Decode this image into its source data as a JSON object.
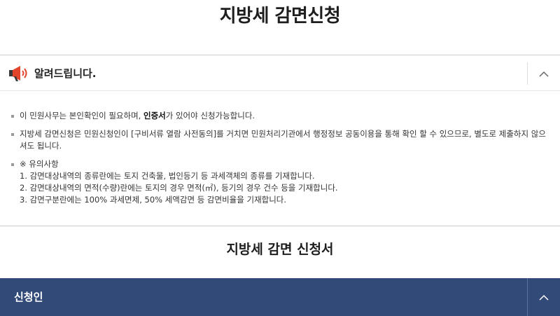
{
  "page": {
    "title": "지방세 감면신청"
  },
  "notice": {
    "title": "알려드립니다.",
    "items": [
      {
        "before": "이 민원사무는 본인확인이 필요하며, ",
        "bold": "인증서",
        "after": "가 있어야 신청가능합니다."
      },
      {
        "text": "지방세 감면신청은 민원신청인이 [구비서류 열람 사전동의]를 거치면 민원처리기관에서 행정정보 공동이용을 통해 확인 할 수 있으므로, 별도로 제출하지 않으셔도 됩니다."
      }
    ],
    "caution": {
      "heading": "※ 유의사항",
      "lines": [
        "1. 감면대상내역의 종류란에는 토지 건축물, 법인등기 등 과세객체의 종류를 기재합니다.",
        "2. 감면대상내역의 면적(수량)란에는 토지의 경우 면적(㎡), 등기의 경우 건수 등을 기재합니다.",
        "3. 감면구분란에는 100% 과세면제, 50% 세액감면 등 감면비율을 기재합니다."
      ]
    }
  },
  "form": {
    "title": "지방세 감면 신청서"
  },
  "applicant": {
    "title": "신청인"
  },
  "colors": {
    "header_bar": "#314a78",
    "megaphone": "#e2452c"
  },
  "icons": {
    "notice": "megaphone-icon",
    "collapse": "chevron-up-icon"
  }
}
